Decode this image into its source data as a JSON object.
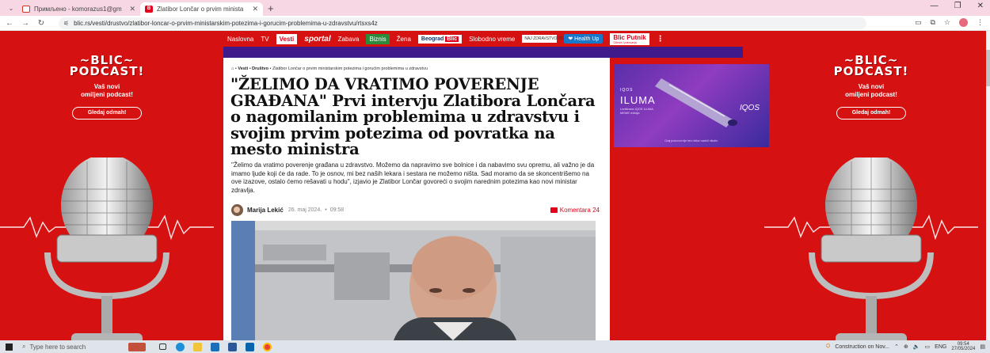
{
  "browser": {
    "tabs": [
      {
        "title": "Примљено - komorazus1@gm",
        "favicon": "gmail-icon"
      },
      {
        "title": "Zlatibor Lončar o prvim ministа",
        "favicon": "blic-icon",
        "active": true
      }
    ],
    "url": "blic.rs/vesti/drustvo/zlatibor-loncar-o-prvim-ministarskim-potezima-i-gorucim-problemima-u-zdravstvu/rtsxs4z"
  },
  "site_nav": {
    "items": [
      "Naslovna",
      "TV",
      "Vesti",
      "sportal",
      "Zabava",
      "Biznis",
      "Žena",
      "Beograd",
      "Slobodno vreme"
    ],
    "beograd_badge": "Blic",
    "naj_badge": "NAJ ZDRAVSTVO 2024",
    "health_up": "Health Up",
    "putnik_brand": "Blic",
    "putnik": "Putnik",
    "putnik_sub": "Odmori i putovanja",
    "more": "⋮"
  },
  "side_ad": {
    "title_line1": "~BLIC~",
    "title_line2": "PODCAST!",
    "subtitle_line1": "Vaš novi",
    "subtitle_line2": "omiljeni podcast!",
    "button": "Gledaj odmah!"
  },
  "article": {
    "breadcrumb": {
      "sep": "•",
      "section": "Vesti",
      "subsection": "Društvo",
      "current": "Zlatibor Lončar o prvim ministarskim potezima i gorućim problemima u zdravstvu"
    },
    "headline": "\"ŽELIMO DA VRATIMO POVERENJE GRAĐANA\" Prvi intervju Zlatibora Lončara o nagomilanim problemima u zdravstvu i svojim prvim potezima od povratka na mesto ministra",
    "lead": "\"Želimo da vratimo poverenje građana u zdravstvo. Možemo da napravimo sve bolnice i da nabavimo svu opremu, ali važno je da imamo ljude koji će da rade. To je osnov, mi bez naših lekara i sestara ne možemo ništa. Sad moramo da se skoncentrišemo na ove izazove, ostalo ćemo rešavati u hodu\", izjavio je Zlatibor Lončar govoreći o svojim narednim potezima kao novi ministar zdravlja.",
    "author": "Marija Lekić",
    "date": "26. maj 2024.",
    "dot": "•",
    "time": "09:58",
    "comments": "Komentara 24"
  },
  "ad": {
    "brand": "IQOS",
    "product": "ILUMA",
    "desc": "Limitirana IQOS ILUMA MEME edicija",
    "logo": "IQOS",
    "footer": "Ovaj proizvod nije bez rizika i sadrži nikotin."
  },
  "taskbar": {
    "search_placeholder": "Type here to search",
    "weather": "Construction on Nov...",
    "lang": "ENG",
    "time": "09:54",
    "date": "27/05/2024"
  }
}
